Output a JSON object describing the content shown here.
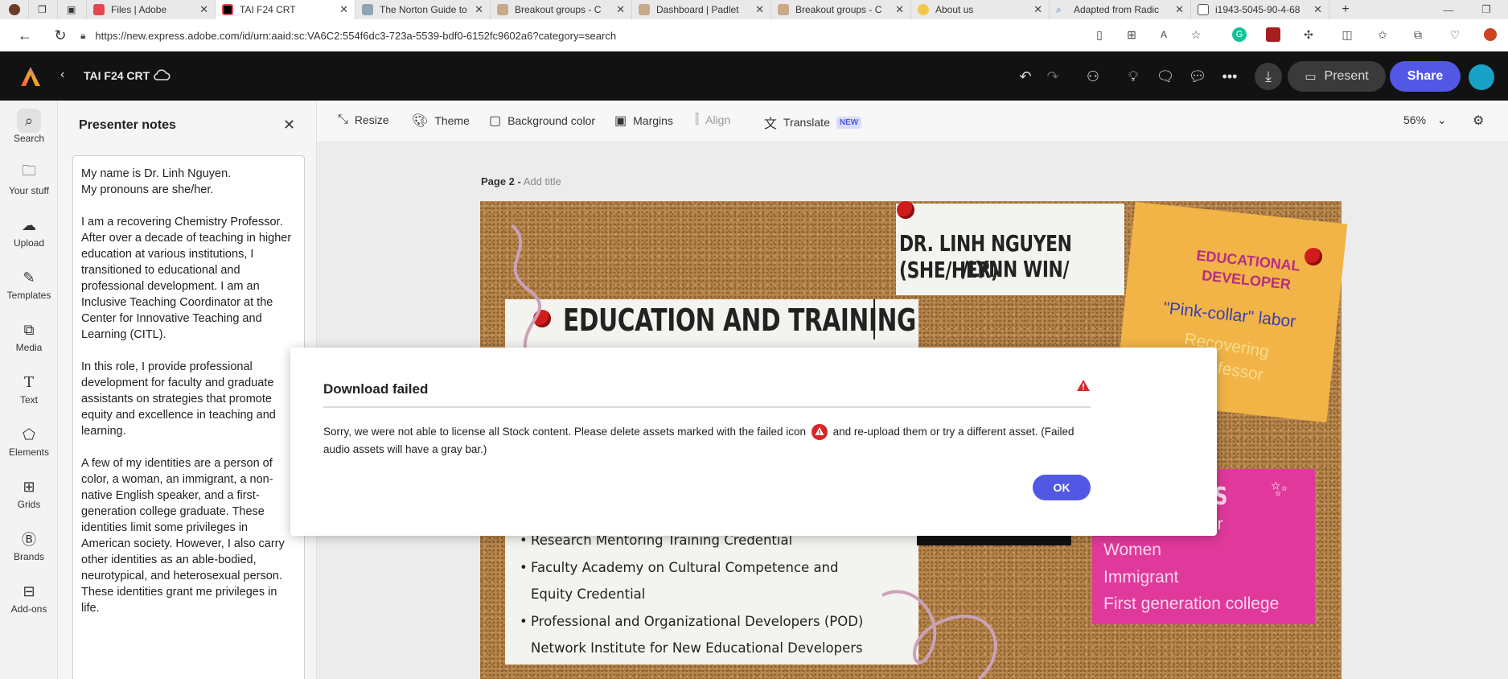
{
  "browser": {
    "tabs": [
      {
        "label": "",
        "icon": "profile-avatar-icon"
      },
      {
        "label": "",
        "icon": "workspaces-icon"
      },
      {
        "label": "",
        "icon": "tab-actions-icon"
      },
      {
        "label": "Files | Adobe",
        "icon": "adobe-icon"
      },
      {
        "label": "TAI F24 CRT",
        "icon": "adobe-express-icon"
      },
      {
        "label": "The Norton Guide to",
        "icon": "norton-icon"
      },
      {
        "label": "Breakout groups - C",
        "icon": "padlet-icon"
      },
      {
        "label": "Dashboard | Padlet",
        "icon": "padlet-icon"
      },
      {
        "label": "Breakout groups - C",
        "icon": "padlet-icon"
      },
      {
        "label": "About us",
        "icon": "smiley-icon"
      },
      {
        "label": "Adapted from Radic",
        "icon": "search-icon"
      },
      {
        "label": "i1943-5045-90-4-68",
        "icon": "document-icon"
      }
    ],
    "url": "https://new.express.adobe.com/id/urn:aaid:sc:VA6C2:554f6dc3-723a-5539-bdf0-6152fc9602a6?category=search"
  },
  "app": {
    "doc_title": "TAI F24 CRT",
    "present_label": "Present",
    "share_label": "Share",
    "accent": "#5258e4"
  },
  "rail": [
    {
      "label": "Search",
      "icon": "search-icon"
    },
    {
      "label": "Your stuff",
      "icon": "folder-icon"
    },
    {
      "label": "Upload",
      "icon": "cloud-upload-icon"
    },
    {
      "label": "Templates",
      "icon": "templates-icon"
    },
    {
      "label": "Media",
      "icon": "media-icon"
    },
    {
      "label": "Text",
      "icon": "text-icon"
    },
    {
      "label": "Elements",
      "icon": "elements-icon"
    },
    {
      "label": "Grids",
      "icon": "grid-icon"
    },
    {
      "label": "Brands",
      "icon": "brands-icon"
    },
    {
      "label": "Add-ons",
      "icon": "addons-icon"
    }
  ],
  "notes": {
    "title": "Presenter notes",
    "paragraphs": [
      "My name is Dr. Linh Nguyen.\nMy pronouns are she/her.",
      "I am a recovering Chemistry Professor. After over a decade of teaching in higher education at various institutions, I transitioned to educational and professional development. I am an Inclusive Teaching Coordinator at the Center for Innovative Teaching and Learning (CITL).",
      "In this role, I provide professional development for faculty and graduate assistants on strategies that promote equity and excellence in teaching and learning.",
      "A few of my identities are a person of color, a woman, an immigrant, a non-native English speaker, and a first-generation college graduate. These identities limit some privileges in American society. However, I also carry other identities as an able-bodied, neurotypical, and heterosexual person. These identities grant me privileges in life."
    ]
  },
  "toolbar": {
    "resize": "Resize",
    "theme": "Theme",
    "background": "Background color",
    "margins": "Margins",
    "align": "Align",
    "translate": "Translate",
    "new_badge": "NEW",
    "zoom": "56%"
  },
  "page": {
    "label": "Page 2 -",
    "add_title": "Add title"
  },
  "slide": {
    "name_line1": "DR. LINH NGUYEN (SHE/HER)",
    "name_line2": "/LYNN WIN/",
    "edu_heading": "EDUCATION AND TRAINING",
    "yellow_title_1": "EDUCATIONAL",
    "yellow_title_2": "DEVELOPER",
    "yellow_line_1": "\"Pink-collar\" labor",
    "yellow_line_2": "Recovering",
    "yellow_line_3": "ry Professor",
    "pink_title": "TIES",
    "pink_items": [
      "or",
      "Women",
      "Immigrant",
      "First generation college"
    ],
    "bullets": [
      "Research Mentoring Training Credential",
      "Faculty Academy on Cultural Competence and",
      "Equity Credential",
      "Professional and Organizational Developers (POD)",
      "Network Institute for New Educational Developers"
    ]
  },
  "modal": {
    "title": "Download failed",
    "body_before": "Sorry, we were not able to license all Stock content. Please delete assets marked with the failed icon",
    "body_after": "and re-upload them or try a different asset. (Failed audio assets will have a gray bar.)",
    "ok_label": "OK",
    "error_color": "#d7262b"
  }
}
